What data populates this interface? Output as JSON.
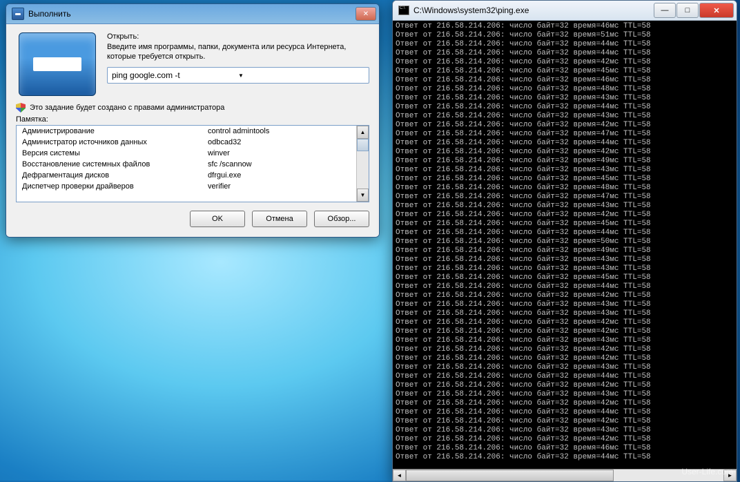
{
  "run": {
    "title": "Выполнить",
    "openLabel": "Открыть:",
    "hint": "Введите имя программы, папки, документа или ресурса Интернета, которые требуется открыть.",
    "command": "ping google.com -t",
    "uacNote": "Это задание будет создано с правами администратора",
    "memLabel": "Памятка:",
    "rows": [
      {
        "name": "Администрирование",
        "cmd": "control admintools"
      },
      {
        "name": "Администратор источников данных",
        "cmd": "odbcad32"
      },
      {
        "name": "Версия системы",
        "cmd": "winver"
      },
      {
        "name": "Восстановление системных файлов",
        "cmd": "sfc /scannow"
      },
      {
        "name": "Дефрагментация дисков",
        "cmd": "dfrgui.exe"
      },
      {
        "name": "Диспетчер проверки драйверов",
        "cmd": "verifier"
      }
    ],
    "buttons": {
      "ok": "OK",
      "cancel": "Отмена",
      "browse": "Обзор..."
    }
  },
  "console": {
    "title": "C:\\Windows\\system32\\ping.exe",
    "prefix": "Ответ от 216.58.214.206: число байт=32 время=",
    "suffix": "мс TTL=58",
    "times": [
      46,
      51,
      44,
      44,
      42,
      45,
      46,
      48,
      43,
      44,
      43,
      42,
      47,
      44,
      42,
      49,
      43,
      45,
      48,
      47,
      43,
      42,
      45,
      44,
      50,
      49,
      43,
      43,
      45,
      44,
      42,
      43,
      43,
      42,
      42,
      43,
      42,
      42,
      43,
      44,
      42,
      43,
      42,
      44,
      42,
      43,
      42,
      46,
      44
    ]
  },
  "watermark": "User-Life.com"
}
